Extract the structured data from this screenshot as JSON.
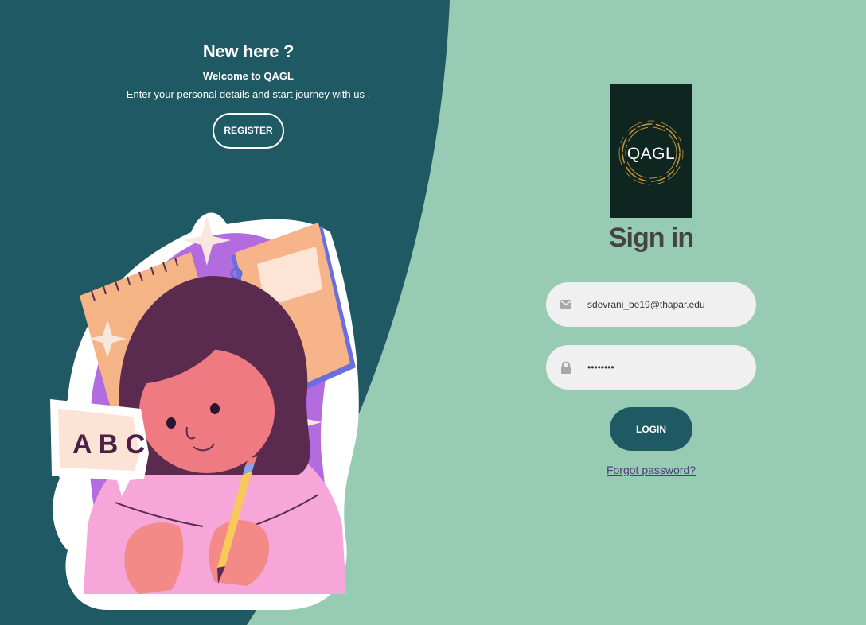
{
  "colors": {
    "page_bg": "#98cbb4",
    "left_bg": "#1f5a64",
    "button_bg": "#1f5a64",
    "input_bg": "#f0f0f0",
    "title_text": "#444444",
    "link_text": "#4b3c7a",
    "logo_bg": "#0f2520",
    "logo_ring": "#c8963e"
  },
  "left_panel": {
    "title": "New here ?",
    "subtitle": "Welcome to QAGL",
    "description": "Enter your personal details and start journey with us .",
    "register_label": "REGISTER"
  },
  "illustration": {
    "speech_bubble_text": "A B C"
  },
  "logo": {
    "text": "QAGL"
  },
  "signin": {
    "title": "Sign in",
    "email": {
      "icon": "envelope-icon",
      "value": "sdevrani_be19@thapar.edu"
    },
    "password": {
      "icon": "lock-icon",
      "value": "12345678"
    },
    "login_label": "LOGIN",
    "forgot_label": "Forgot password?"
  }
}
